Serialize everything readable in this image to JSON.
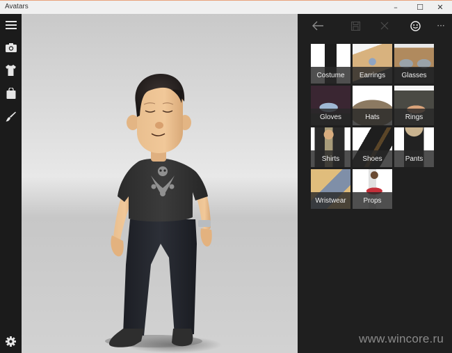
{
  "window": {
    "title": "Avatars",
    "controls": {
      "minimize": "–",
      "maximize": "☐",
      "close": "✕"
    }
  },
  "rail": {
    "items": [
      {
        "name": "menu",
        "icon": "hamburger-icon"
      },
      {
        "name": "camera",
        "icon": "camera-icon"
      },
      {
        "name": "style",
        "icon": "shirt-icon"
      },
      {
        "name": "store",
        "icon": "shopping-bag-icon"
      },
      {
        "name": "customize",
        "icon": "paintbrush-icon"
      }
    ],
    "footer": {
      "name": "settings",
      "icon": "gear-icon"
    }
  },
  "commandbar": {
    "back": {
      "icon": "back-arrow-icon",
      "enabled": true
    },
    "save": {
      "icon": "save-icon",
      "enabled": false
    },
    "cancel": {
      "icon": "close-icon",
      "enabled": false
    },
    "avatar": {
      "icon": "smiley-icon",
      "enabled": true
    },
    "more": {
      "icon": "more-icon",
      "label": "···"
    }
  },
  "categories": [
    {
      "label": "Costume",
      "thumb": "costume",
      "colors": [
        "#ffffff",
        "#1c1c1c"
      ]
    },
    {
      "label": "Earrings",
      "thumb": "earrings",
      "colors": [
        "#d8b27e",
        "#8fa4c2"
      ]
    },
    {
      "label": "Glasses",
      "thumb": "glasses",
      "colors": [
        "#b08a5e",
        "#2b2b2b"
      ]
    },
    {
      "label": "Gloves",
      "thumb": "gloves",
      "colors": [
        "#3a2632",
        "#9fb8d4"
      ]
    },
    {
      "label": "Hats",
      "thumb": "hats",
      "colors": [
        "#ffffff",
        "#8c7a62"
      ]
    },
    {
      "label": "Rings",
      "thumb": "rings",
      "colors": [
        "#4a4a44",
        "#d9a37a"
      ]
    },
    {
      "label": "Shirts",
      "thumb": "shirts",
      "colors": [
        "#ffffff",
        "#2a2a2a"
      ]
    },
    {
      "label": "Shoes",
      "thumb": "shoes",
      "colors": [
        "#ffffff",
        "#1e1e1e"
      ]
    },
    {
      "label": "Pants",
      "thumb": "pants",
      "colors": [
        "#ffffff",
        "#222222"
      ]
    },
    {
      "label": "Wristwear",
      "thumb": "wristwear",
      "colors": [
        "#7f8fa8",
        "#e0bd7c"
      ]
    },
    {
      "label": "Props",
      "thumb": "props",
      "colors": [
        "#ffffff",
        "#c4303a"
      ]
    }
  ],
  "watermark": "www.wincore.ru",
  "colors": {
    "titlebar": "#f0f0f0",
    "rail": "#1b1b1b",
    "panel": "#1f1f1f",
    "accent_border": "#e8a27a"
  }
}
